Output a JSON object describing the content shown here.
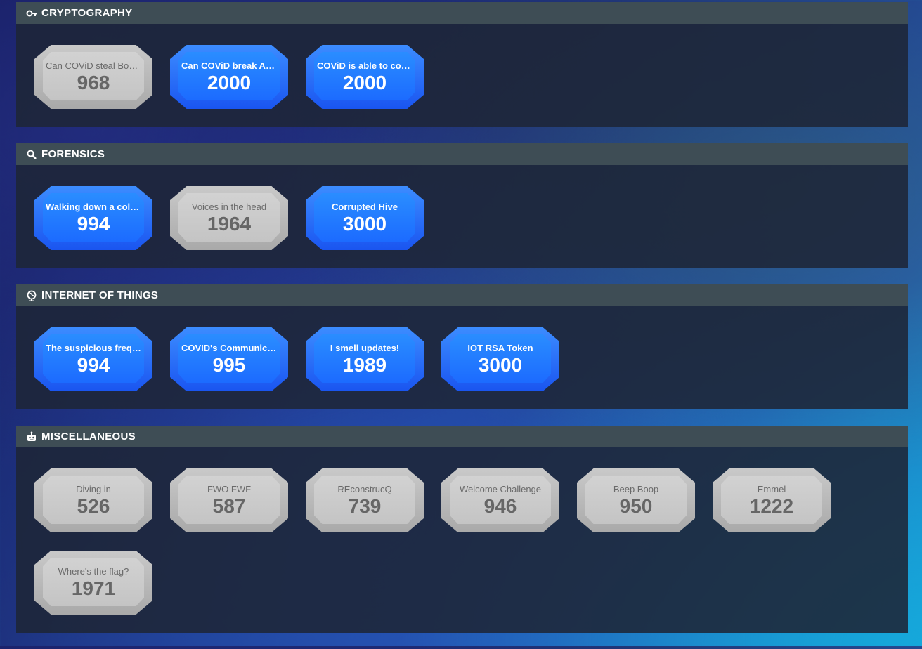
{
  "categories": [
    {
      "title": "CRYPTOGRAPHY",
      "icon": "key-icon",
      "challenges": [
        {
          "name": "Can COViD steal Bob's…",
          "points": "968",
          "solved": false
        },
        {
          "name": "Can COViD break Alice…",
          "points": "2000",
          "solved": true
        },
        {
          "name": "COViD is able to comp…",
          "points": "2000",
          "solved": true
        }
      ]
    },
    {
      "title": "FORENSICS",
      "icon": "search-icon",
      "challenges": [
        {
          "name": "Walking down a colou…",
          "points": "994",
          "solved": true
        },
        {
          "name": "Voices in the head",
          "points": "1964",
          "solved": false
        },
        {
          "name": "Corrupted Hive",
          "points": "3000",
          "solved": true
        }
      ]
    },
    {
      "title": "INTERNET OF THINGS",
      "icon": "globe-icon",
      "challenges": [
        {
          "name": "The suspicious freque…",
          "points": "994",
          "solved": true
        },
        {
          "name": "COVID's Communicati…",
          "points": "995",
          "solved": true
        },
        {
          "name": "I smell updates!",
          "points": "1989",
          "solved": true
        },
        {
          "name": "IOT RSA Token",
          "points": "3000",
          "solved": true
        }
      ]
    },
    {
      "title": "MISCELLANEOUS",
      "icon": "robot-icon",
      "challenges": [
        {
          "name": "Diving in",
          "points": "526",
          "solved": false
        },
        {
          "name": "FWO FWF",
          "points": "587",
          "solved": false
        },
        {
          "name": "REconstrucQ",
          "points": "739",
          "solved": false
        },
        {
          "name": "Welcome Challenge",
          "points": "946",
          "solved": false
        },
        {
          "name": "Beep Boop",
          "points": "950",
          "solved": false
        },
        {
          "name": "Emmel",
          "points": "1222",
          "solved": false
        },
        {
          "name": "Where's the flag?",
          "points": "1971",
          "solved": false
        }
      ]
    }
  ]
}
